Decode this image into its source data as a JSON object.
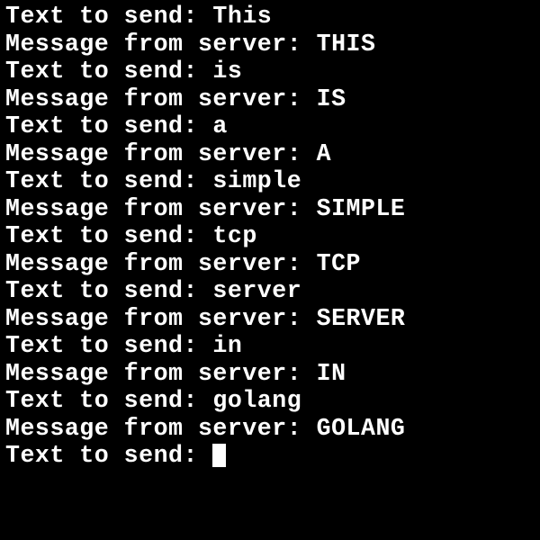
{
  "prompt_prefix": "Text to send: ",
  "response_prefix": "Message from server: ",
  "exchanges": [
    {
      "input": "This",
      "output": "THIS"
    },
    {
      "input": "is",
      "output": "IS"
    },
    {
      "input": "a",
      "output": "A"
    },
    {
      "input": "simple",
      "output": "SIMPLE"
    },
    {
      "input": "tcp",
      "output": "TCP"
    },
    {
      "input": "server",
      "output": "SERVER"
    },
    {
      "input": "in",
      "output": "IN"
    },
    {
      "input": "golang",
      "output": "GOLANG"
    }
  ],
  "pending_prompt": "Text to send: "
}
